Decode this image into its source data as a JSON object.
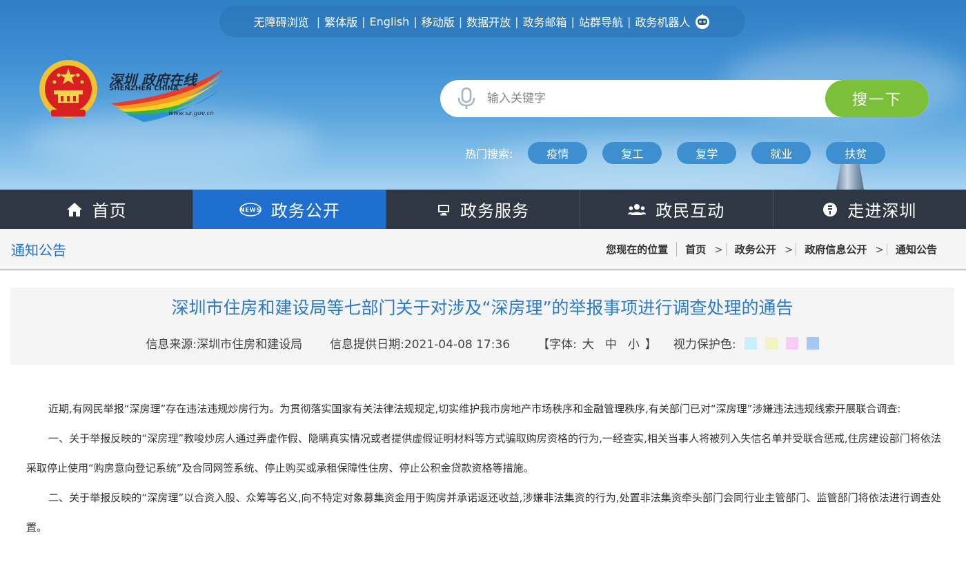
{
  "topbar": {
    "links": [
      "无障碍浏览",
      "繁体版",
      "English",
      "移动版",
      "数据开放",
      "政务邮箱",
      "站群导航",
      "政务机器人"
    ],
    "robot_icon": "robot-icon"
  },
  "logo": {
    "emblem_icon": "national-emblem-icon",
    "brand_cn": "深圳 政府在线",
    "brand_en": "SHENZHEN CHINA",
    "url": "www.sz.gov.cn"
  },
  "search": {
    "placeholder": "输入关键字",
    "button": "搜一下",
    "mic_icon": "microphone-icon"
  },
  "hot": {
    "label": "热门搜索:",
    "tags": [
      "疫情",
      "复工",
      "复学",
      "就业",
      "扶贫"
    ]
  },
  "nav": {
    "items": [
      {
        "label": "首页",
        "icon": "home-icon"
      },
      {
        "label": "政务公开",
        "icon": "news-icon"
      },
      {
        "label": "政务服务",
        "icon": "monitor-icon"
      },
      {
        "label": "政民互动",
        "icon": "people-icon"
      },
      {
        "label": "走进深圳",
        "icon": "city-icon"
      }
    ],
    "active_index": 1
  },
  "crumb": {
    "section_title": "通知公告",
    "position_label": "您现在的位置",
    "items": [
      "首页",
      "政务公开",
      "政府信息公开",
      "通知公告"
    ],
    "separator": ">"
  },
  "article": {
    "title": "深圳市住房和建设局等七部门关于对涉及“深房理”的举报事项进行调查处理的通告",
    "source": "信息来源:深圳市住房和建设局",
    "date": "信息提供日期:2021-04-08 17:36",
    "font_label": "【字体:",
    "font_sizes": [
      "大",
      "中",
      "小"
    ],
    "font_close": "】",
    "eye_label": "视力保护色:",
    "eye_colors": [
      "#c9f0fa",
      "#f5f3c4",
      "#f8ccf5",
      "#a3c8f3"
    ],
    "paragraphs": [
      "近期,有网民举报“深房理”存在违法违规炒房行为。为贯彻落实国家有关法律法规规定,切实维护我市房地产市场秩序和金融管理秩序,有关部门已对“深房理”涉嫌违法违规线索开展联合调查:",
      "一、关于举报反映的“深房理”教唆炒房人通过弄虚作假、隐瞒真实情况或者提供虚假证明材料等方式骗取购房资格的行为,一经查实,相关当事人将被列入失信名单并受联合惩戒,住房建设部门将依法采取停止使用“购房意向登记系统”及合同网签系统、停止购买或承租保障性住房、停止公积金贷款资格等措施。",
      "二、关于举报反映的“深房理”以合资入股、众筹等名义,向不特定对象募集资金用于购房并承诺返还收益,涉嫌非法集资的行为,处置非法集资牵头部门会同行业主管部门、监管部门将依法进行调查处置。"
    ]
  },
  "colors": {
    "nav_bg": "#2e3743",
    "nav_active": "#1f6fd0",
    "search_button": "#7cc03a",
    "title_blue": "#2a7ac9",
    "hot_tag": "#3d8fcf"
  }
}
